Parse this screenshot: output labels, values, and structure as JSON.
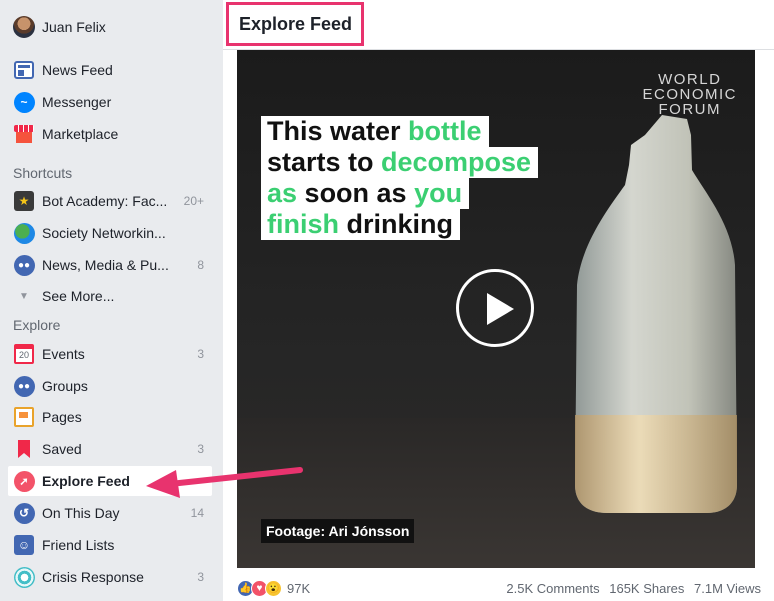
{
  "user": {
    "name": "Juan Felix"
  },
  "nav": {
    "top": [
      {
        "label": "News Feed"
      },
      {
        "label": "Messenger"
      },
      {
        "label": "Marketplace"
      }
    ],
    "shortcuts_heading": "Shortcuts",
    "shortcuts": [
      {
        "label": "Bot Academy: Fac...",
        "count": "20+"
      },
      {
        "label": "Society Networkin...",
        "count": ""
      },
      {
        "label": "News, Media & Pu...",
        "count": "8"
      }
    ],
    "see_more": "See More...",
    "explore_heading": "Explore",
    "explore": [
      {
        "label": "Events",
        "count": "3",
        "icon_text": "20"
      },
      {
        "label": "Groups",
        "count": ""
      },
      {
        "label": "Pages",
        "count": ""
      },
      {
        "label": "Saved",
        "count": "3"
      },
      {
        "label": "Explore Feed",
        "count": ""
      },
      {
        "label": "On This Day",
        "count": "14"
      },
      {
        "label": "Friend Lists",
        "count": ""
      },
      {
        "label": "Crisis Response",
        "count": "3"
      }
    ]
  },
  "main": {
    "title": "Explore Feed",
    "video": {
      "brand_lines": [
        "WORLD",
        "ECONOMIC",
        "FORUM"
      ],
      "headline": [
        [
          {
            "t": "This water ",
            "c": "k"
          },
          {
            "t": "bottle",
            "c": "g"
          }
        ],
        [
          {
            "t": "starts to ",
            "c": "k"
          },
          {
            "t": "decompose",
            "c": "g"
          }
        ],
        [
          {
            "t": "as",
            "c": "g"
          },
          {
            "t": " soon as ",
            "c": "k"
          },
          {
            "t": "you",
            "c": "g"
          }
        ],
        [
          {
            "t": "finish",
            "c": "g"
          },
          {
            "t": " drinking",
            "c": "k"
          }
        ]
      ],
      "caption": "Footage: Ari Jónsson"
    },
    "reactions_count": "97K",
    "comments": "2.5K Comments",
    "shares": "165K Shares",
    "views": "7.1M Views"
  },
  "colors": {
    "accent_pink": "#e8336e",
    "fb_blue": "#4267b2",
    "green_text": "#3bcf72"
  }
}
